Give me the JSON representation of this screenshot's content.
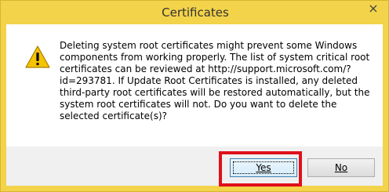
{
  "window": {
    "title": "Certificates",
    "close_glyph": "×"
  },
  "dialog": {
    "message": "Deleting system root certificates might prevent some Windows components from working properly. The list of system critical root certificates can be reviewed at http://support.microsoft.com/?id=293781. If Update Root Certificates is installed, any deleted third-party root certificates will be restored automatically, but the system root certificates will not. Do you want to delete the selected certificate(s)?",
    "icon": "warning-icon"
  },
  "buttons": {
    "yes_label": "Yes",
    "no_label": "No"
  },
  "colors": {
    "titlebar": "#f3d34a",
    "highlight": "#e0101a",
    "warning": "#f5c400"
  }
}
